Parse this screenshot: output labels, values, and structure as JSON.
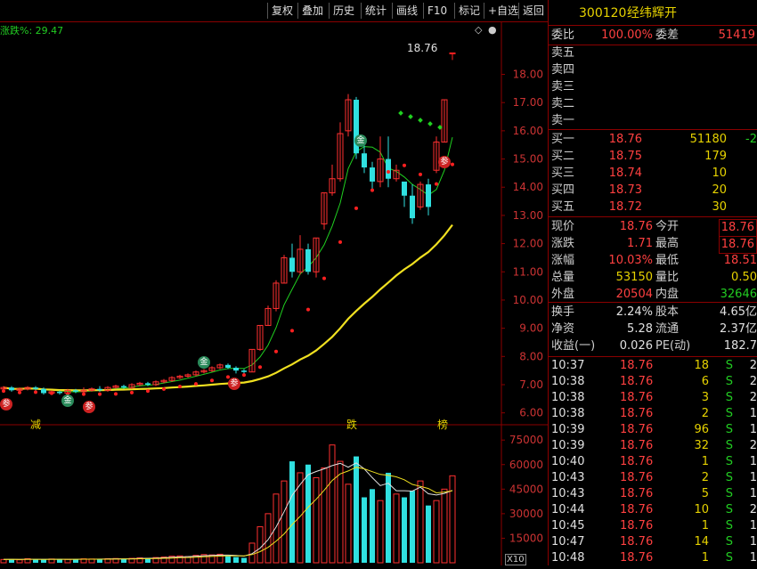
{
  "toolbar": {
    "buttons": [
      "复权",
      "叠加",
      "历史",
      "统计",
      "画线",
      "F10",
      "标记",
      "+自选",
      "返回"
    ]
  },
  "indicator_header": {
    "label": "涨跌%: 29.47"
  },
  "price_marker": {
    "label": "18.76"
  },
  "event_labels": {
    "jian": "减",
    "die": "跌",
    "bang": "榜"
  },
  "badges": {
    "shen": "参",
    "jin": "金"
  },
  "volume_multiplier": "X10",
  "stock": {
    "code": "300120",
    "name": "经纬辉开"
  },
  "weibi": {
    "label": "委比",
    "value": "100.00%",
    "label2": "委差",
    "value2": "51419"
  },
  "sell": [
    {
      "label": "卖五"
    },
    {
      "label": "卖四"
    },
    {
      "label": "卖三"
    },
    {
      "label": "卖二"
    },
    {
      "label": "卖一"
    }
  ],
  "buy": [
    {
      "label": "买一",
      "price": "18.76",
      "vol": "51180",
      "chg": "-2"
    },
    {
      "label": "买二",
      "price": "18.75",
      "vol": "179",
      "chg": ""
    },
    {
      "label": "买三",
      "price": "18.74",
      "vol": "10",
      "chg": ""
    },
    {
      "label": "买四",
      "price": "18.73",
      "vol": "20",
      "chg": ""
    },
    {
      "label": "买五",
      "price": "18.72",
      "vol": "30",
      "chg": ""
    }
  ],
  "quote": {
    "xianjia": {
      "label": "现价",
      "value": "18.76",
      "label2": "今开",
      "value2": "18.76"
    },
    "zhangdie": {
      "label": "涨跌",
      "value": "1.71",
      "label2": "最高",
      "value2": "18.76"
    },
    "zhangfu": {
      "label": "涨幅",
      "value": "10.03%",
      "label2": "最低",
      "value2": "18.51"
    },
    "zongliang": {
      "label": "总量",
      "value": "53150",
      "label2": "量比",
      "value2": "0.50"
    },
    "waipan": {
      "label": "外盘",
      "value": "20504",
      "label2": "内盘",
      "value2": "32646"
    },
    "huanshou": {
      "label": "换手",
      "value": "2.24%",
      "label2": "股本",
      "value2": "4.65亿"
    },
    "jingzi": {
      "label": "净资",
      "value": "5.28",
      "label2": "流通",
      "value2": "2.37亿"
    },
    "shouyi": {
      "label": "收益(一)",
      "value": "0.026",
      "label2": "PE(动)",
      "value2": "182.7"
    }
  },
  "ticks": [
    {
      "time": "10:37",
      "price": "18.76",
      "vol": "18",
      "side": "S",
      "n": "2"
    },
    {
      "time": "10:38",
      "price": "18.76",
      "vol": "6",
      "side": "S",
      "n": "2"
    },
    {
      "time": "10:38",
      "price": "18.76",
      "vol": "3",
      "side": "S",
      "n": "2"
    },
    {
      "time": "10:38",
      "price": "18.76",
      "vol": "2",
      "side": "S",
      "n": "1"
    },
    {
      "time": "10:39",
      "price": "18.76",
      "vol": "96",
      "side": "S",
      "n": "1"
    },
    {
      "time": "10:39",
      "price": "18.76",
      "vol": "32",
      "side": "S",
      "n": "2"
    },
    {
      "time": "10:40",
      "price": "18.76",
      "vol": "1",
      "side": "S",
      "n": "1"
    },
    {
      "time": "10:43",
      "price": "18.76",
      "vol": "2",
      "side": "S",
      "n": "1"
    },
    {
      "time": "10:43",
      "price": "18.76",
      "vol": "5",
      "side": "S",
      "n": "1"
    },
    {
      "time": "10:44",
      "price": "18.76",
      "vol": "10",
      "side": "S",
      "n": "2"
    },
    {
      "time": "10:45",
      "price": "18.76",
      "vol": "1",
      "side": "S",
      "n": "1"
    },
    {
      "time": "10:47",
      "price": "18.76",
      "vol": "14",
      "side": "S",
      "n": "1"
    },
    {
      "time": "10:48",
      "price": "18.76",
      "vol": "1",
      "side": "S",
      "n": "1"
    }
  ],
  "chart_data": {
    "type": "candlestick",
    "price_axis": {
      "ticks": [
        "6.00",
        "7.00",
        "8.00",
        "9.00",
        "10.00",
        "11.00",
        "12.00",
        "13.00",
        "14.00",
        "15.00",
        "16.00",
        "17.00",
        "18.00"
      ],
      "range": [
        5.8,
        18.9
      ]
    },
    "volume_axis": {
      "ticks": [
        "15000",
        "30000",
        "45000",
        "60000",
        "75000"
      ],
      "range": [
        0,
        80000
      ]
    },
    "candles": [
      [
        6.85,
        6.9,
        6.8,
        6.95
      ],
      [
        6.9,
        6.8,
        6.75,
        6.95
      ],
      [
        6.8,
        6.85,
        6.75,
        6.9
      ],
      [
        6.85,
        6.9,
        6.8,
        6.95
      ],
      [
        6.9,
        6.85,
        6.8,
        6.95
      ],
      [
        6.85,
        6.7,
        6.65,
        6.9
      ],
      [
        6.7,
        6.75,
        6.65,
        6.8
      ],
      [
        6.75,
        6.7,
        6.65,
        6.8
      ],
      [
        6.7,
        6.8,
        6.65,
        6.85
      ],
      [
        6.8,
        6.75,
        6.7,
        6.85
      ],
      [
        6.75,
        6.8,
        6.7,
        6.9
      ],
      [
        6.8,
        6.85,
        6.75,
        6.9
      ],
      [
        6.85,
        6.8,
        6.75,
        6.95
      ],
      [
        6.8,
        6.9,
        6.75,
        6.95
      ],
      [
        6.9,
        6.95,
        6.85,
        7.0
      ],
      [
        6.95,
        6.9,
        6.85,
        7.0
      ],
      [
        6.9,
        7.0,
        6.85,
        7.05
      ],
      [
        7.0,
        7.05,
        6.95,
        7.1
      ],
      [
        7.05,
        7.0,
        6.95,
        7.1
      ],
      [
        7.0,
        7.1,
        6.95,
        7.15
      ],
      [
        7.1,
        7.15,
        7.05,
        7.2
      ],
      [
        7.15,
        7.25,
        7.1,
        7.3
      ],
      [
        7.25,
        7.3,
        7.2,
        7.35
      ],
      [
        7.3,
        7.35,
        7.25,
        7.4
      ],
      [
        7.35,
        7.45,
        7.3,
        7.5
      ],
      [
        7.45,
        7.5,
        7.4,
        7.55
      ],
      [
        7.5,
        7.6,
        7.45,
        7.65
      ],
      [
        7.6,
        7.7,
        7.55,
        7.75
      ],
      [
        7.7,
        7.6,
        7.55,
        7.75
      ],
      [
        7.6,
        7.5,
        7.4,
        7.65
      ],
      [
        7.5,
        7.45,
        7.35,
        7.55
      ],
      [
        7.45,
        8.25,
        7.45,
        8.25
      ],
      [
        8.25,
        9.1,
        8.2,
        9.1
      ],
      [
        9.1,
        9.7,
        9.1,
        9.8
      ],
      [
        9.7,
        10.6,
        9.6,
        10.7
      ],
      [
        10.6,
        11.5,
        10.6,
        11.6
      ],
      [
        11.5,
        11.0,
        10.8,
        12.0
      ],
      [
        11.0,
        11.8,
        10.9,
        12.3
      ],
      [
        11.8,
        11.0,
        10.9,
        12.0
      ],
      [
        11.0,
        12.2,
        10.8,
        12.2
      ],
      [
        12.7,
        13.8,
        12.5,
        13.8
      ],
      [
        13.8,
        14.3,
        13.7,
        14.8
      ],
      [
        14.3,
        15.9,
        14.2,
        16.3
      ],
      [
        16.0,
        17.1,
        15.8,
        17.3
      ],
      [
        17.1,
        15.2,
        15.0,
        17.2
      ],
      [
        15.2,
        14.7,
        14.5,
        15.8
      ],
      [
        14.7,
        14.2,
        13.9,
        14.9
      ],
      [
        14.2,
        15.0,
        14.0,
        15.8
      ],
      [
        15.0,
        14.3,
        14.0,
        15.8
      ],
      [
        14.3,
        14.6,
        14.2,
        14.8
      ],
      [
        14.2,
        13.7,
        13.3,
        14.1
      ],
      [
        13.7,
        12.9,
        12.7,
        14.1
      ],
      [
        13.3,
        14.1,
        13.2,
        14.2
      ],
      [
        14.1,
        13.3,
        13.0,
        14.3
      ],
      [
        14.6,
        15.6,
        14.5,
        15.8
      ],
      [
        15.6,
        17.1,
        15.6,
        17.1
      ],
      [
        18.76,
        18.76,
        18.51,
        18.76
      ]
    ],
    "volumes": [
      2000,
      2200,
      1800,
      2500,
      2100,
      1900,
      2300,
      2000,
      2100,
      2200,
      2400,
      2300,
      2100,
      2500,
      2600,
      2400,
      2700,
      3000,
      2800,
      3200,
      3500,
      4000,
      4200,
      3800,
      4500,
      5000,
      4800,
      5200,
      4000,
      3500,
      3000,
      12000,
      22000,
      30000,
      42000,
      50000,
      62000,
      55000,
      60000,
      52000,
      58000,
      72000,
      62000,
      48000,
      65000,
      40000,
      45000,
      38000,
      55000,
      42000,
      40000,
      44000,
      50000,
      35000,
      38000,
      45000,
      53150
    ]
  }
}
